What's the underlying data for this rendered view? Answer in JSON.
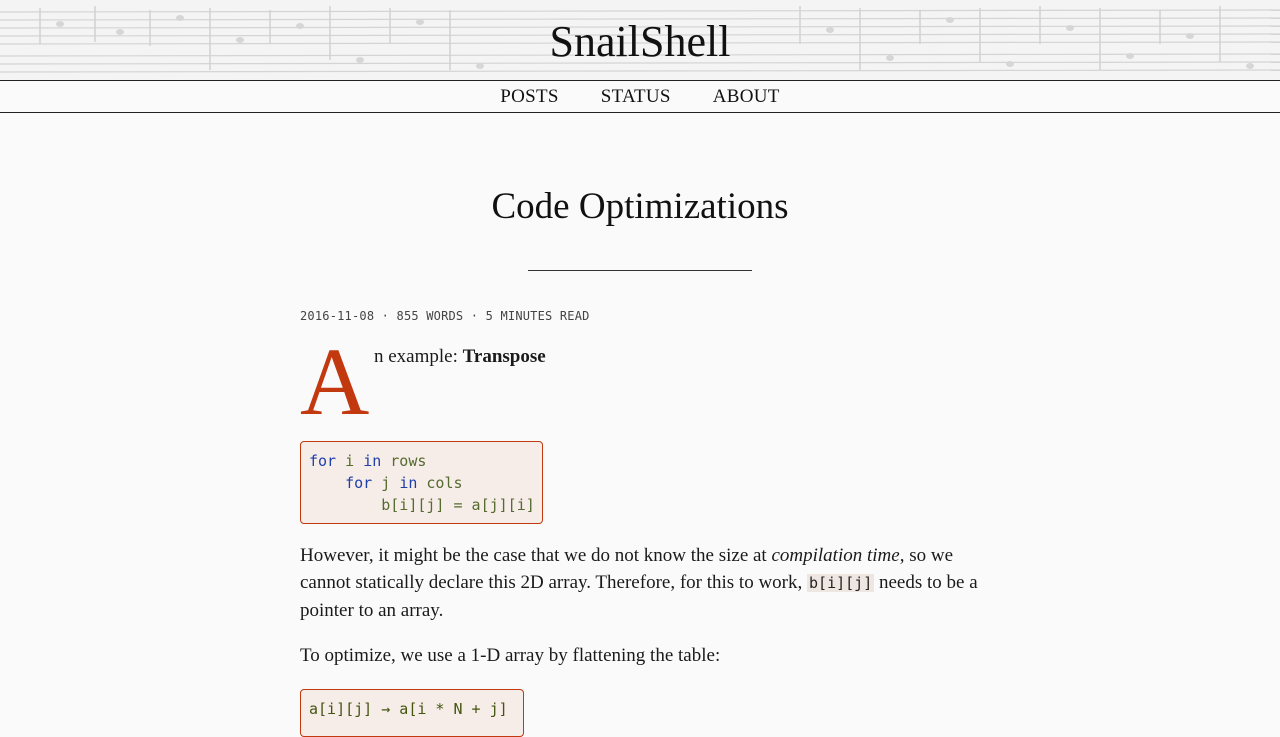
{
  "site": {
    "title": "SnailShell"
  },
  "nav": {
    "items": [
      "POSTS",
      "STATUS",
      "ABOUT"
    ]
  },
  "post": {
    "title": "Code Optimizations",
    "meta": "2016-11-08 · 855 WORDS · 5 MINUTES READ",
    "dropcap": "A",
    "intro_rest": "n example: ",
    "intro_bold": "Transpose",
    "code1": {
      "line1": [
        "for",
        " i ",
        "in",
        " rows"
      ],
      "line2": [
        "    for",
        " j ",
        "in",
        " cols"
      ],
      "line3": "        b[i][j] = a[j][i]"
    },
    "para1": {
      "before_em": "However, it might be the case that we do not know the size at ",
      "em": "compilation time",
      "after_em": ", so we cannot statically declare this 2D array. Therefore, for this to work, ",
      "code": "b[i][j]",
      "after_code": " needs to be a pointer to an array."
    },
    "para2": "To optimize, we use a 1-D array by flattening the table:",
    "code2": "a[i][j] → a[i * N + j]"
  },
  "colors": {
    "accent": "#c2380f",
    "code_bg": "#f6ece8",
    "keyword": "#1f3fa8"
  }
}
